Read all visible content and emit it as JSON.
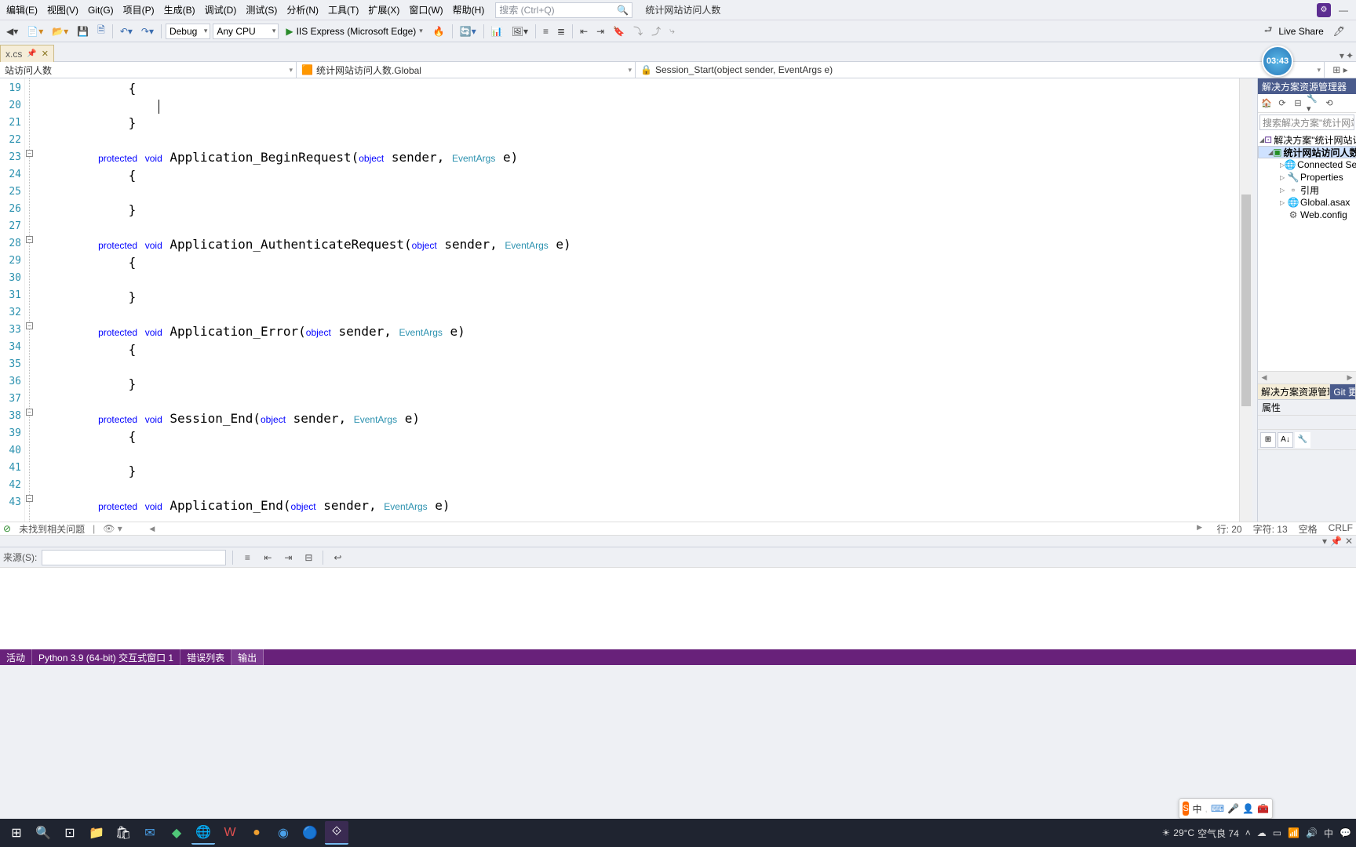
{
  "menu": {
    "items": [
      "编辑(E)",
      "视图(V)",
      "Git(G)",
      "项目(P)",
      "生成(B)",
      "调试(D)",
      "测试(S)",
      "分析(N)",
      "工具(T)",
      "扩展(X)",
      "窗口(W)",
      "帮助(H)"
    ],
    "search_ph": "搜索 (Ctrl+Q)",
    "project": "统计网站访问人数"
  },
  "toolbar": {
    "config": "Debug",
    "platform": "Any CPU",
    "run": "IIS Express (Microsoft Edge)",
    "liveshare": "Live Share"
  },
  "tab": {
    "name": "x.cs"
  },
  "nav": {
    "l": "站访问人数",
    "m": "统计网站访问人数.Global",
    "r": "Session_Start(object sender, EventArgs e)"
  },
  "lines": {
    "start": 19,
    "count": 25
  },
  "code": {
    "m1": "Application_BeginRequest",
    "m2": "Application_AuthenticateRequest",
    "m3": "Application_Error",
    "m4": "Session_End",
    "m5": "Application_End",
    "prot": "protected",
    "void": "void",
    "obj": "object",
    "snd": " sender, ",
    "ea": "EventArgs",
    "e": " e)"
  },
  "timer": "03:43",
  "se": {
    "title": "源管理器",
    "search": "搜索解决方案\"统计网站访问",
    "sln": "解决方案\"统计网站访问人",
    "proj": "统计网站访问人数",
    "conn": "Connected Serv",
    "props": "Properties",
    "refs": "引用",
    "glob": "Global.asax",
    "web": "Web.config",
    "tab1": "解决方案资源管理器",
    "tab2": "Git 更"
  },
  "props": {
    "title": "属性"
  },
  "status": {
    "issues": "未找到相关问题",
    "ln": "行: 20",
    "ch": "字符: 13",
    "sp": "空格",
    "eol": "CRLF"
  },
  "out": {
    "src": "来源(S):"
  },
  "bottom": {
    "items": [
      "活动",
      "Python 3.9 (64-bit) 交互式窗口 1",
      "错误列表",
      "输出"
    ]
  },
  "tray": {
    "temp": "29°C",
    "aqi": "空气良 74"
  },
  "sogou": {
    "label": "中"
  }
}
